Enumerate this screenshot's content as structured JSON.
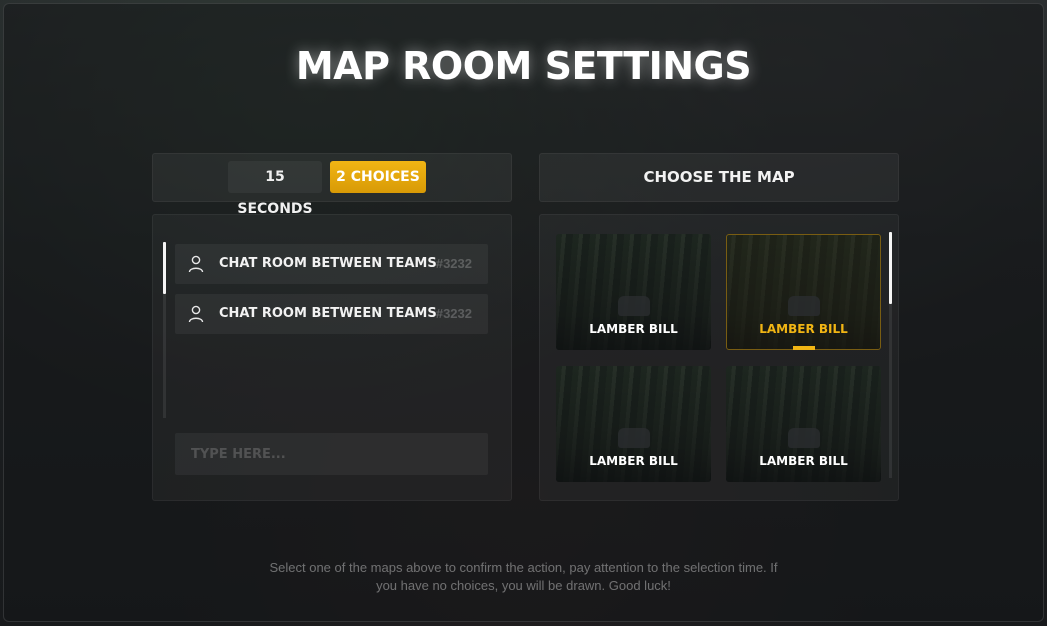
{
  "title": "MAP ROOM SETTINGS",
  "tabs": [
    {
      "label": "15 SECONDS",
      "active": false
    },
    {
      "label": "2 CHOICES",
      "active": true
    }
  ],
  "chat": {
    "rows": [
      {
        "label": "CHAT ROOM BETWEEN TEAMS",
        "id": "#3232",
        "icon": "user-icon"
      },
      {
        "label": "CHAT ROOM BETWEEN TEAMS",
        "id": "#3232",
        "icon": "user-icon"
      }
    ],
    "input_placeholder": "TYPE HERE..."
  },
  "maps": {
    "header": "CHOOSE THE MAP",
    "cards": [
      {
        "name": "LAMBER BILL",
        "selected": false
      },
      {
        "name": "LAMBER BILL",
        "selected": true
      },
      {
        "name": "LAMBER BILL",
        "selected": false
      },
      {
        "name": "LAMBER BILL",
        "selected": false
      }
    ]
  },
  "footer": "Select one of the maps above to confirm the action, pay attention to the selection time. If you have no choices, you will be drawn. Good luck!",
  "colors": {
    "accent": "#f1b514",
    "text": "#ffffff"
  }
}
